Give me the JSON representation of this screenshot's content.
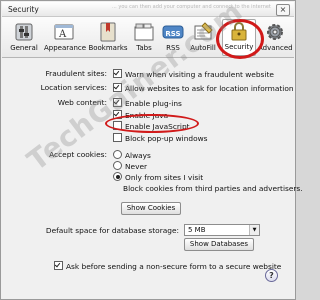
{
  "window": {
    "title": "Security",
    "faded_header_text": "... you can then add your computer and connect to the internet",
    "close_label": "×"
  },
  "toolbar": {
    "items": [
      {
        "label": "General",
        "icon": "switch-icon"
      },
      {
        "label": "Appearance",
        "icon": "appearance-icon"
      },
      {
        "label": "Bookmarks",
        "icon": "bookmarks-icon"
      },
      {
        "label": "Tabs",
        "icon": "tabs-icon"
      },
      {
        "label": "RSS",
        "icon": "rss-icon",
        "badge": "RSS"
      },
      {
        "label": "AutoFill",
        "icon": "autofill-icon"
      },
      {
        "label": "Security",
        "icon": "lock-icon",
        "selected": true
      },
      {
        "label": "Advanced",
        "icon": "gear-icon"
      }
    ]
  },
  "settings": {
    "fraudulent": {
      "label": "Fraudulent sites:",
      "option": "Warn when visiting a fraudulent website",
      "checked": true
    },
    "location": {
      "label": "Location services:",
      "option": "Allow websites to ask for location information",
      "checked": true
    },
    "web_content": {
      "label": "Web content:",
      "plugins": {
        "option": "Enable plug-ins",
        "checked": true
      },
      "java": {
        "option": "Enable Java",
        "checked": true
      },
      "javascript": {
        "option": "Enable JavaScript",
        "checked": false
      },
      "popups": {
        "option": "Block pop-up windows",
        "checked": false
      }
    },
    "cookies": {
      "label": "Accept cookies:",
      "options": [
        "Always",
        "Never",
        "Only from sites I visit"
      ],
      "selected_index": 2,
      "note": "Block cookies from third parties and advertisers.",
      "show_button": "Show Cookies"
    },
    "database": {
      "label": "Default space for database storage:",
      "value": "5 MB",
      "show_button": "Show Databases"
    },
    "nonsecure": {
      "option": "Ask before sending a non-secure form to a secure website",
      "checked": true
    }
  },
  "watermark": "TechGainer.com",
  "help_label": "?",
  "colors": {
    "annotation": "#d11a1a"
  }
}
